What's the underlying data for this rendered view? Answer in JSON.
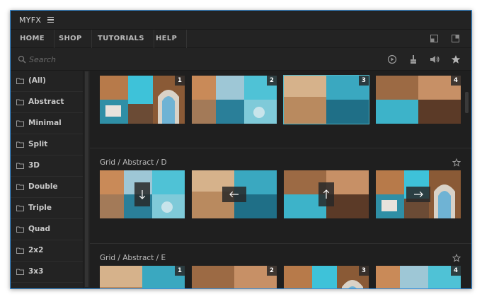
{
  "app": {
    "title": "MYFX"
  },
  "nav": {
    "items": [
      "HOME",
      "SHOP",
      "TUTORIALS",
      "HELP"
    ]
  },
  "search": {
    "placeholder": "Search",
    "value": ""
  },
  "sidebar": {
    "items": [
      {
        "label": "(All)"
      },
      {
        "label": "Abstract"
      },
      {
        "label": "Minimal"
      },
      {
        "label": "Split"
      },
      {
        "label": "3D"
      },
      {
        "label": "Double"
      },
      {
        "label": "Triple"
      },
      {
        "label": "Quad"
      },
      {
        "label": "2x2"
      },
      {
        "label": "3x3"
      }
    ]
  },
  "sections": [
    {
      "title": "",
      "thumbnails": [
        {
          "badge": "1"
        },
        {
          "badge": "2"
        },
        {
          "badge": "3"
        },
        {
          "badge": "4"
        }
      ]
    },
    {
      "title": "Grid / Abstract / D",
      "thumbnails": [
        {
          "arrow": "down"
        },
        {
          "arrow": "left"
        },
        {
          "arrow": "up"
        },
        {
          "arrow": "right"
        }
      ]
    },
    {
      "title": "Grid / Abstract / E",
      "thumbnails": [
        {
          "badge": "1"
        },
        {
          "badge": "2"
        },
        {
          "badge": "3"
        },
        {
          "badge": "4"
        }
      ]
    }
  ],
  "colors": {
    "accent": "#3b8fd9",
    "selection": "#4fb6c8",
    "background": "#232323"
  }
}
